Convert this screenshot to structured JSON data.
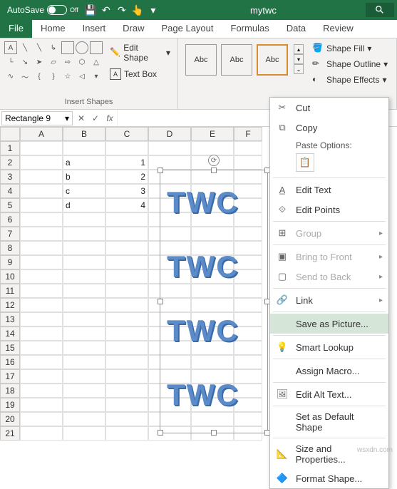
{
  "titlebar": {
    "autosave": "AutoSave",
    "autosave_state": "Off",
    "doc": "mytwc"
  },
  "tabs": [
    "File",
    "Home",
    "Insert",
    "Draw",
    "Page Layout",
    "Formulas",
    "Data",
    "Review"
  ],
  "ribbon": {
    "insert_shapes_label": "Insert Shapes",
    "edit_shape": "Edit Shape",
    "text_box": "Text Box",
    "style_sample": "Abc",
    "shape_styles_label": "S",
    "shape_fill": "Shape Fill",
    "shape_outline": "Shape Outline",
    "shape_effects": "Shape Effects"
  },
  "name_box": "Rectangle 9",
  "formula_bar": {
    "cancel": "✕",
    "confirm": "✓",
    "fx": "fx"
  },
  "columns": [
    "A",
    "B",
    "C",
    "D",
    "E",
    "F"
  ],
  "rows": 21,
  "cells": {
    "B2": "a",
    "B3": "b",
    "B4": "c",
    "B5": "d",
    "C2": "1",
    "C3": "2",
    "C4": "3",
    "C5": "4"
  },
  "twc_text": "TWC",
  "context_menu": {
    "cut": "Cut",
    "copy": "Copy",
    "paste_options": "Paste Options:",
    "edit_text": "Edit Text",
    "edit_points": "Edit Points",
    "group": "Group",
    "bring_front": "Bring to Front",
    "send_back": "Send to Back",
    "link": "Link",
    "save_as_picture": "Save as Picture...",
    "smart_lookup": "Smart Lookup",
    "assign_macro": "Assign Macro...",
    "edit_alt_text": "Edit Alt Text...",
    "set_default": "Set as Default Shape",
    "size_props": "Size and Properties...",
    "format_shape": "Format Shape..."
  },
  "watermark": "wsxdn.com"
}
